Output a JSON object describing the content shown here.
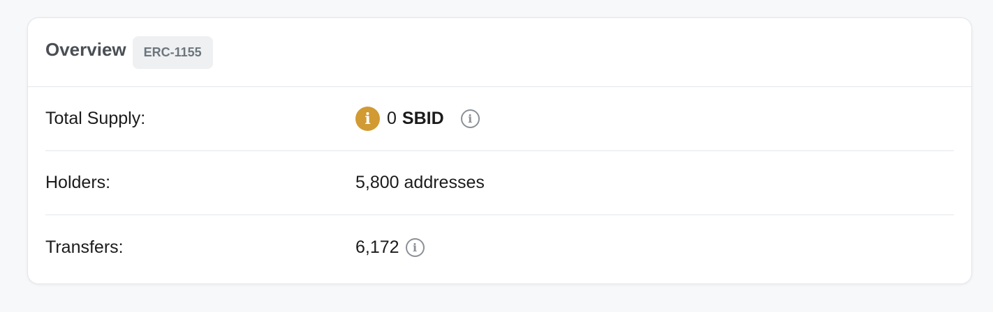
{
  "overview": {
    "title": "Overview",
    "badge": "ERC-1155"
  },
  "rows": {
    "total_supply": {
      "label": "Total Supply:",
      "token_icon_glyph": "i",
      "amount": "0",
      "symbol": "SBID",
      "info_icon": "info-icon",
      "info_glyph": "i"
    },
    "holders": {
      "label": "Holders:",
      "value": "5,800 addresses"
    },
    "transfers": {
      "label": "Transfers:",
      "value": "6,172",
      "info_icon": "info-icon",
      "info_glyph": "i"
    }
  },
  "colors": {
    "token_icon": "#d19a33",
    "badge_bg": "#eef0f2",
    "border": "#e3e6ea"
  }
}
